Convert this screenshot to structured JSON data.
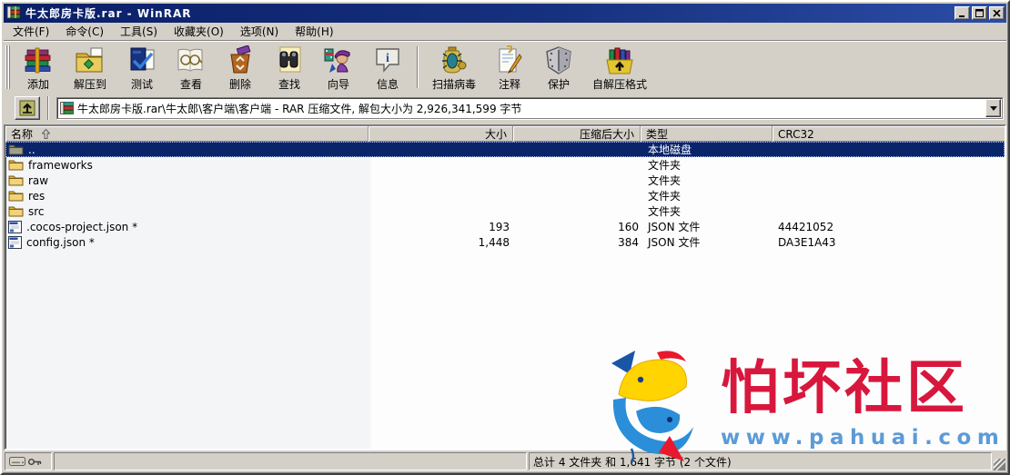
{
  "window": {
    "title": "牛太郎房卡版.rar - WinRAR"
  },
  "menu": {
    "items": [
      "文件(F)",
      "命令(C)",
      "工具(S)",
      "收藏夹(O)",
      "选项(N)",
      "帮助(H)"
    ]
  },
  "toolbar": {
    "buttons": [
      {
        "label": "添加",
        "icon": "add-archive-icon"
      },
      {
        "label": "解压到",
        "icon": "extract-to-icon"
      },
      {
        "label": "测试",
        "icon": "test-icon"
      },
      {
        "label": "查看",
        "icon": "view-icon"
      },
      {
        "label": "删除",
        "icon": "delete-icon"
      },
      {
        "label": "查找",
        "icon": "find-icon"
      },
      {
        "label": "向导",
        "icon": "wizard-icon"
      },
      {
        "label": "信息",
        "icon": "info-icon"
      },
      {
        "label": "扫描病毒",
        "icon": "scan-virus-icon"
      },
      {
        "label": "注释",
        "icon": "comment-icon"
      },
      {
        "label": "保护",
        "icon": "protect-icon"
      },
      {
        "label": "自解压格式",
        "icon": "sfx-icon"
      }
    ]
  },
  "address": {
    "path": "牛太郎房卡版.rar\\牛太郎\\客户端\\客户端 - RAR 压缩文件, 解包大小为 2,926,341,599 字节"
  },
  "columns": {
    "name": "名称",
    "size": "大小",
    "packed": "压缩后大小",
    "type": "类型",
    "crc": "CRC32"
  },
  "files": [
    {
      "name": "..",
      "size": "",
      "packed": "",
      "type": "本地磁盘",
      "crc": "",
      "icon": "updir-folder-icon",
      "selected": true
    },
    {
      "name": "frameworks",
      "size": "",
      "packed": "",
      "type": "文件夹",
      "crc": "",
      "icon": "folder-icon"
    },
    {
      "name": "raw",
      "size": "",
      "packed": "",
      "type": "文件夹",
      "crc": "",
      "icon": "folder-icon"
    },
    {
      "name": "res",
      "size": "",
      "packed": "",
      "type": "文件夹",
      "crc": "",
      "icon": "folder-icon"
    },
    {
      "name": "src",
      "size": "",
      "packed": "",
      "type": "文件夹",
      "crc": "",
      "icon": "folder-icon"
    },
    {
      "name": ".cocos-project.json *",
      "size": "193",
      "packed": "160",
      "type": "JSON 文件",
      "crc": "44421052",
      "icon": "json-file-icon"
    },
    {
      "name": "config.json *",
      "size": "1,448",
      "packed": "384",
      "type": "JSON 文件",
      "crc": "DA3E1A43",
      "icon": "json-file-icon"
    }
  ],
  "statusbar": {
    "totals": "总计 4 文件夹 和 1,641 字节 (2 个文件)"
  },
  "watermark": {
    "title": "怕坏社区",
    "url": "www.pahuai.com",
    "title_color": "#d8173d",
    "url_color": "#5b9bd8"
  },
  "colors": {
    "titlebar_start": "#0a1f68",
    "titlebar_end": "#2c4da6",
    "chrome_gray": "#d4d0c8",
    "selection_blue": "#0a246a"
  }
}
